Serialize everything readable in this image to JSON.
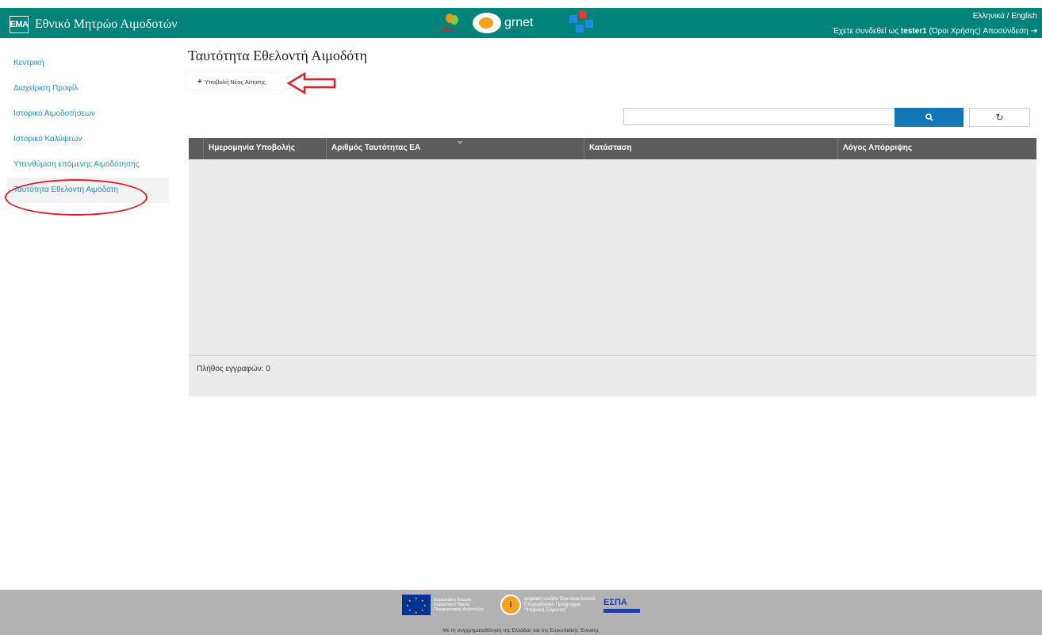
{
  "header": {
    "logo_text": "ΕΜΑ",
    "title": "Εθνικό Μητρώο Αιμοδοτών",
    "partner_logos": [
      "ekea-logo",
      "grnet-logo",
      "cross-logo"
    ],
    "grnet_text": "grnet",
    "ekea_text": "ΕΚΕΑ",
    "language_links": "Ελληνικά / English",
    "session_prefix": "Έχετε συνδεθεί ως",
    "username": "tester1",
    "terms_link": "(Όροι Χρήσης)",
    "logout_link": "Αποσύνδεση"
  },
  "sidebar": {
    "items": [
      {
        "label": "Κεντρική"
      },
      {
        "label": "Διαχείριση Προφίλ"
      },
      {
        "label": "Ιστορικό Αιμοδοτήσεων"
      },
      {
        "label": "Ιστορικό Καλύψεων"
      },
      {
        "label": "Υπενθύμιση επόμενης Αιμοδότησης"
      },
      {
        "label": "Ταυτότητα Εθελοντή Αιμοδότη"
      }
    ],
    "active_index": 5
  },
  "main": {
    "page_title": "Ταυτότητα Εθελοντή Αιμοδότη",
    "new_request_button": "Υποβολή Νέας Αίτησης",
    "search_placeholder": "",
    "reset_icon": "↻",
    "grid": {
      "columns": [
        "Ημερομηνία Υποβολής",
        "Αριθμός Ταυτότητας ΕΑ",
        "Κατάσταση",
        "Λόγος Απόρριψης"
      ],
      "rows": [],
      "record_count": "Πλήθος εγγραφών: 0"
    }
  },
  "footer": {
    "eu_text": "Ευρωπαϊκή Ένωση Ευρωπαϊκό Ταμείο Περιφερειακής Ανάπτυξης",
    "digital_text": "ψηφιακή ελλάδα Όλα είναι δυνατά Επιχειρησιακό Πρόγραμμα \"Ψηφιακή Σύγκλιση\"",
    "espa_text": "ΕΣΠΑ",
    "caption": "Με τη συγχρηματοδότηση της Ελλάδας και της Ευρωπαϊκής Ένωσης"
  },
  "colors": {
    "header_bg": "#00847a",
    "link": "#1e90c8",
    "annotation_red": "#e31e24",
    "search_button": "#1177b7",
    "grid_header": "#5c5c5c"
  }
}
